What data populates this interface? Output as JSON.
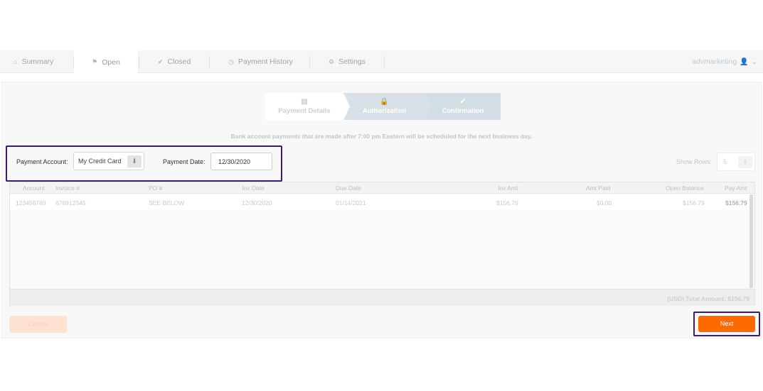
{
  "nav": {
    "tabs": [
      {
        "icon": "home-icon",
        "glyph": "⌂",
        "label": "Summary"
      },
      {
        "icon": "flag-icon",
        "glyph": "⚑",
        "label": "Open"
      },
      {
        "icon": "check-icon",
        "glyph": "✔",
        "label": "Closed"
      },
      {
        "icon": "clock-icon",
        "glyph": "◷",
        "label": "Payment History"
      },
      {
        "icon": "gear-icon",
        "glyph": "⚙",
        "label": "Settings"
      }
    ],
    "active_tab": "Open",
    "user": {
      "name": "advmarketing",
      "icon_glyph": "👤",
      "chevron": "⌄"
    }
  },
  "wizard": {
    "steps": [
      {
        "icon": "calendar-icon",
        "glyph": "▤",
        "label": "Payment Details"
      },
      {
        "icon": "lock-icon",
        "glyph": "🔒",
        "label": "Authorization"
      },
      {
        "icon": "check-icon",
        "glyph": "✔",
        "label": "Confirmation"
      }
    ]
  },
  "notice": "Bank account payments that are made after 7:00 pm Eastern will be scheduled for the next business day.",
  "form": {
    "payment_account_label": "Payment Account:",
    "payment_account_value": "My Credit Card",
    "payment_date_label": "Payment Date:",
    "payment_date_value": "12/30/2020",
    "dropdown_glyph": "⬇"
  },
  "show_rows": {
    "label": "Show Rows:",
    "value": "5"
  },
  "table": {
    "columns": [
      "Account",
      "Invoice #",
      "PO #",
      "Inv Date",
      "Due Date",
      "Inv Amt",
      "Amt Paid",
      "Open Balance",
      "Pay Amt"
    ],
    "rows": [
      {
        "account": "123456789",
        "invoice": "678912345",
        "po": "SEE BELOW",
        "inv_date": "12/30/2020",
        "due_date": "01/14/2021",
        "inv_amt": "$156.79",
        "amt_paid": "$0.00",
        "open_balance": "$156.79",
        "pay_amt": "$156.79"
      }
    ],
    "total": "(USD) Total Amount: $156.79"
  },
  "buttons": {
    "cancel": "Cancel",
    "next": "Next"
  },
  "colors": {
    "accent": "#ff6a00",
    "highlight": "#3d1a78"
  }
}
